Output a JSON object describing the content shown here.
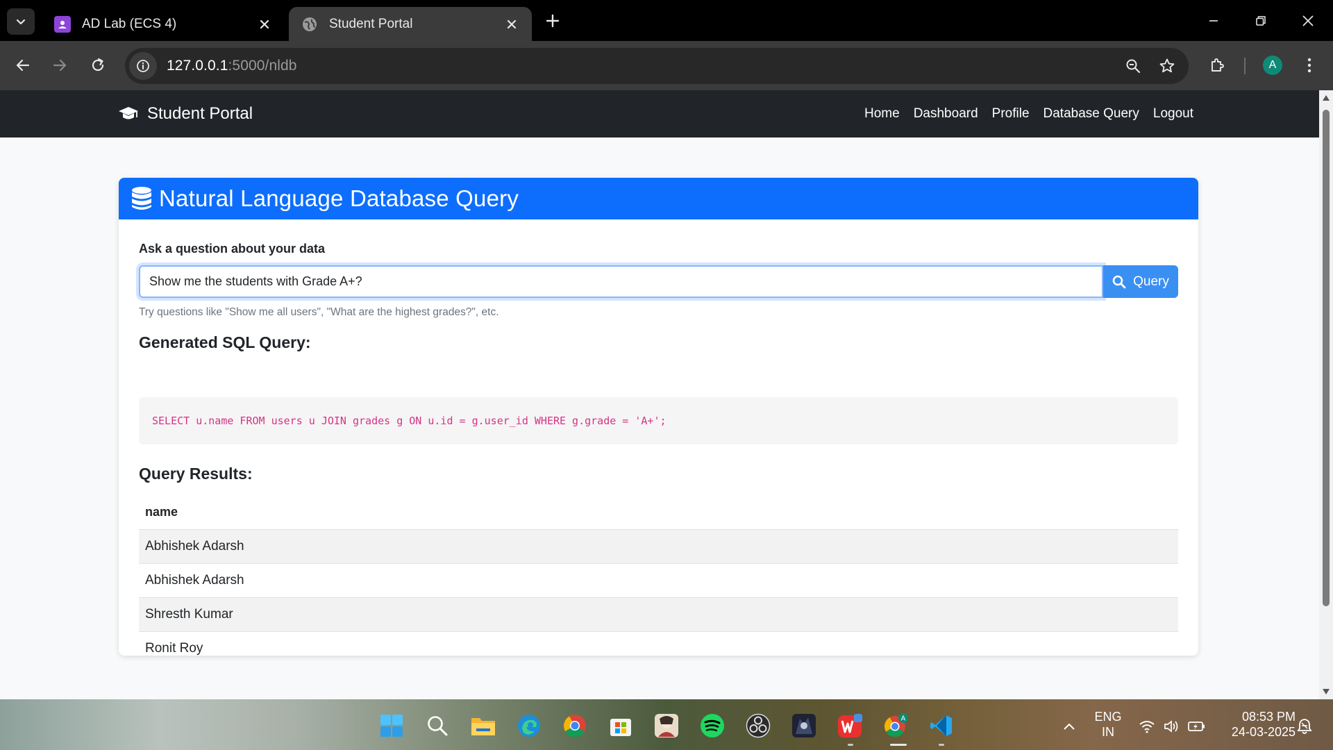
{
  "browser": {
    "tabs": [
      {
        "title": "AD Lab (ECS 4)",
        "active": false
      },
      {
        "title": "Student Portal",
        "active": true
      }
    ],
    "url_host": "127.0.0.1",
    "url_path": ":5000/nldb",
    "profile_initial": "A"
  },
  "navbar": {
    "brand": "Student Portal",
    "links": [
      "Home",
      "Dashboard",
      "Profile",
      "Database Query",
      "Logout"
    ]
  },
  "card": {
    "title": "Natural Language Database Query",
    "question_label": "Ask a question about your data",
    "question_value": "Show me the students with Grade A+?",
    "query_button": "Query",
    "hint": "Try questions like \"Show me all users\", \"What are the highest grades?\", etc.",
    "sql_heading": "Generated SQL Query:",
    "sql": "SELECT u.name FROM users u JOIN grades g ON u.id = g.user_id WHERE g.grade = 'A+';",
    "results_heading": "Query Results:",
    "results": {
      "columns": [
        "name"
      ],
      "rows": [
        [
          "Abhishek Adarsh"
        ],
        [
          "Abhishek Adarsh"
        ],
        [
          "Shresth Kumar"
        ],
        [
          "Ronit Roy"
        ]
      ]
    }
  },
  "taskbar": {
    "apps": [
      "start-icon",
      "search-icon",
      "file-explorer-icon",
      "edge-icon",
      "chrome-icon",
      "microsoft-store-icon",
      "photos-app-icon",
      "spotify-icon",
      "obs-icon",
      "game-app-icon",
      "wps-office-icon",
      "chrome-profile-icon",
      "vscode-icon"
    ],
    "lang_line1": "ENG",
    "lang_line2": "IN",
    "time": "08:53 PM",
    "date": "24-03-2025"
  },
  "colors": {
    "primary": "#0d6efd",
    "navbar": "#212529",
    "sql_text": "#d63384",
    "button": "#3a8ff2"
  }
}
